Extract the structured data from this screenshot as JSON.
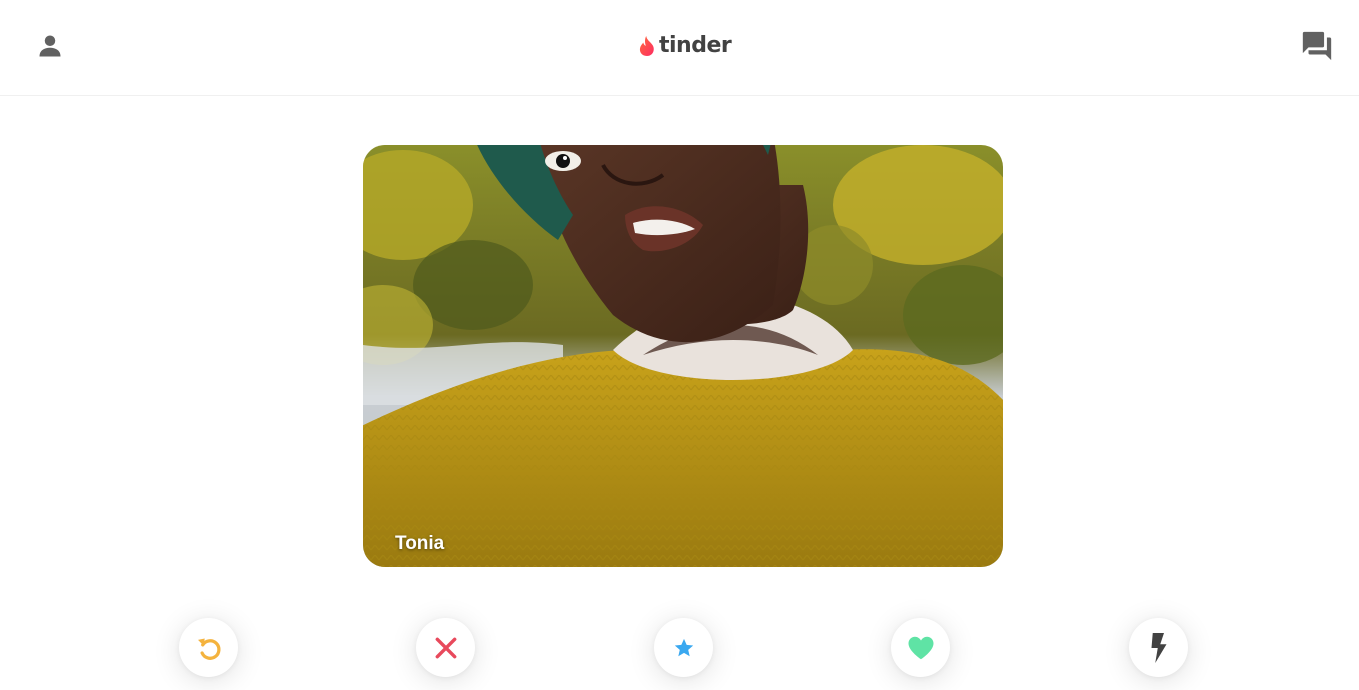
{
  "header": {
    "logo_text": "tinder",
    "profile_icon": "person-icon",
    "messages_icon": "forum-icon"
  },
  "card": {
    "name": "Tonia"
  },
  "actions": [
    {
      "name": "rewind",
      "icon": "rewind-icon",
      "color": "#f4b33e"
    },
    {
      "name": "nope",
      "icon": "close-icon",
      "color": "#e8495c"
    },
    {
      "name": "super-like",
      "icon": "star-icon",
      "color": "#3aa8f0"
    },
    {
      "name": "like",
      "icon": "heart-icon",
      "color": "#5fe3a5"
    },
    {
      "name": "boost",
      "icon": "lightning-icon",
      "color": "#424242"
    }
  ],
  "colors": {
    "brand": "#fd4e5e",
    "icon_gray": "#616161"
  }
}
